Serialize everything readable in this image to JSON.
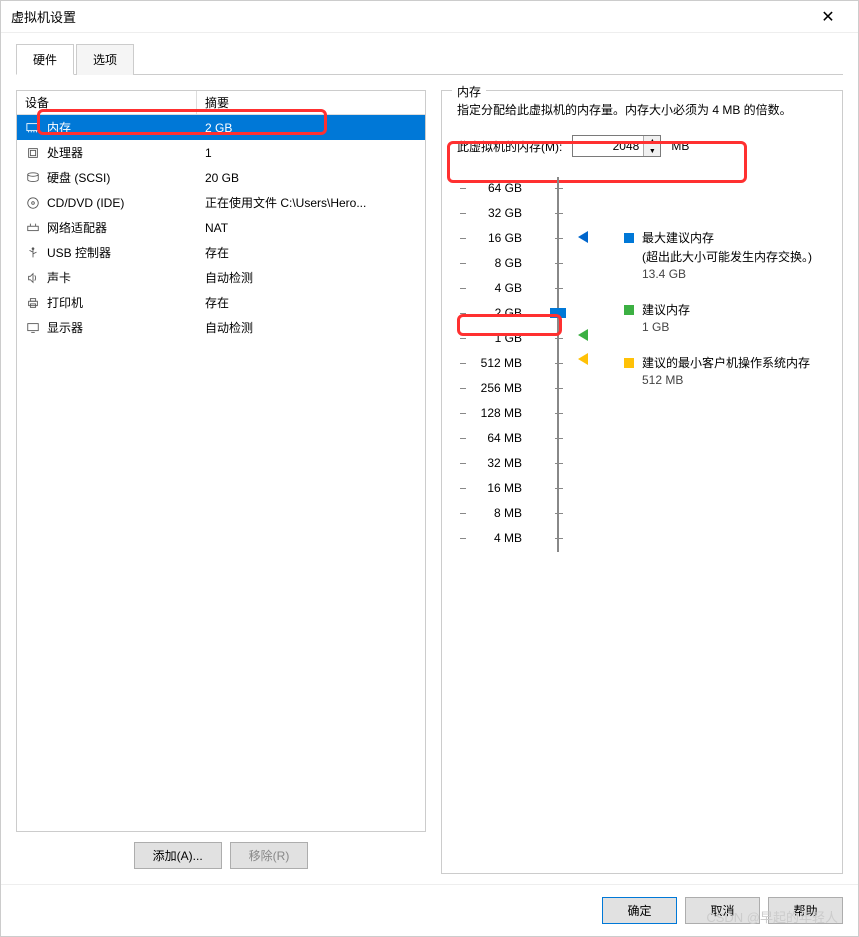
{
  "title": "虚拟机设置",
  "tabs": {
    "hardware": "硬件",
    "options": "选项"
  },
  "listHeader": {
    "device": "设备",
    "summary": "摘要"
  },
  "devices": [
    {
      "name": "内存",
      "summary": "2 GB",
      "icon": "memory",
      "selected": true
    },
    {
      "name": "处理器",
      "summary": "1",
      "icon": "cpu"
    },
    {
      "name": "硬盘 (SCSI)",
      "summary": "20 GB",
      "icon": "disk"
    },
    {
      "name": "CD/DVD (IDE)",
      "summary": "正在使用文件 C:\\Users\\Hero...",
      "icon": "cd"
    },
    {
      "name": "网络适配器",
      "summary": "NAT",
      "icon": "network"
    },
    {
      "name": "USB 控制器",
      "summary": "存在",
      "icon": "usb"
    },
    {
      "name": "声卡",
      "summary": "自动检测",
      "icon": "sound"
    },
    {
      "name": "打印机",
      "summary": "存在",
      "icon": "printer"
    },
    {
      "name": "显示器",
      "summary": "自动检测",
      "icon": "display"
    }
  ],
  "buttons": {
    "add": "添加(A)...",
    "remove": "移除(R)",
    "ok": "确定",
    "cancel": "取消",
    "help": "帮助"
  },
  "memory": {
    "title": "内存",
    "desc": "指定分配给此虚拟机的内存量。内存大小必须为 4 MB 的倍数。",
    "label": "此虚拟机的内存(M):",
    "value": "2048",
    "unit": "MB",
    "ticks": [
      "64 GB",
      "32 GB",
      "16 GB",
      "8 GB",
      "4 GB",
      "2 GB",
      "1 GB",
      "512 MB",
      "256 MB",
      "128 MB",
      "64 MB",
      "32 MB",
      "16 MB",
      "8 MB",
      "4 MB"
    ],
    "info": {
      "max": {
        "title": "最大建议内存",
        "note": "(超出此大小可能发生内存交换。)",
        "value": "13.4 GB"
      },
      "rec": {
        "title": "建议内存",
        "value": "1 GB"
      },
      "min": {
        "title": "建议的最小客户机操作系统内存",
        "value": "512 MB"
      }
    }
  },
  "watermark": "CSDN @早起的年轻人"
}
